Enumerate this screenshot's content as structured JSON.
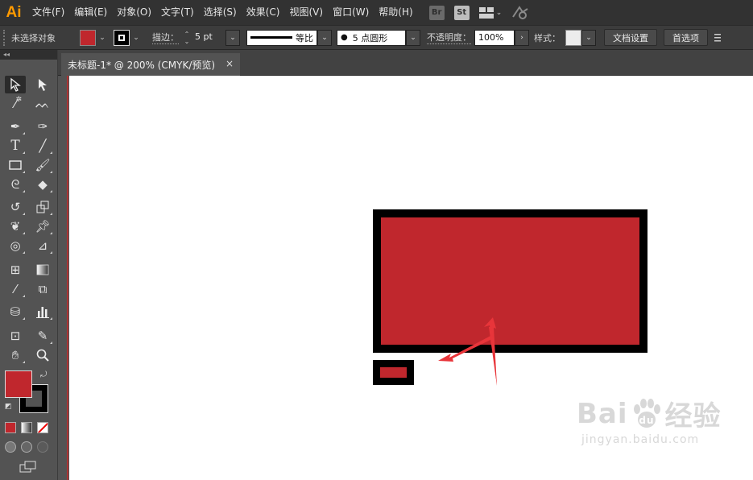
{
  "app": {
    "logo": "Ai"
  },
  "menu": [
    "文件(F)",
    "编辑(E)",
    "对象(O)",
    "文字(T)",
    "选择(S)",
    "效果(C)",
    "视图(V)",
    "窗口(W)",
    "帮助(H)"
  ],
  "menu_right": {
    "bridge": "Br",
    "stock": "St"
  },
  "control": {
    "selection_state": "未选择对象",
    "fill_color": "#c0272d",
    "stroke_label": "描边：",
    "stroke_value": "5 pt",
    "profile_label": "等比",
    "brush_label": "5 点圆形",
    "opacity_label": "不透明度：",
    "opacity_value": "100%",
    "style_label": "样式：",
    "doc_settings": "文档设置",
    "preferences": "首选项"
  },
  "tab": {
    "title": "未标题-1* @ 200% (CMYK/预览)",
    "close": "×"
  },
  "toolbox": {
    "header": "◂◂",
    "fill_color": "#c0272d",
    "stroke_color": "#000000"
  },
  "canvas": {
    "shape_fill": "#c0272d",
    "shape_stroke": "#000000",
    "arrow_color": "#e8353a"
  },
  "watermark": {
    "main_left": "Bai",
    "main_right": "经验",
    "sub": "jingyan.baidu.com"
  }
}
